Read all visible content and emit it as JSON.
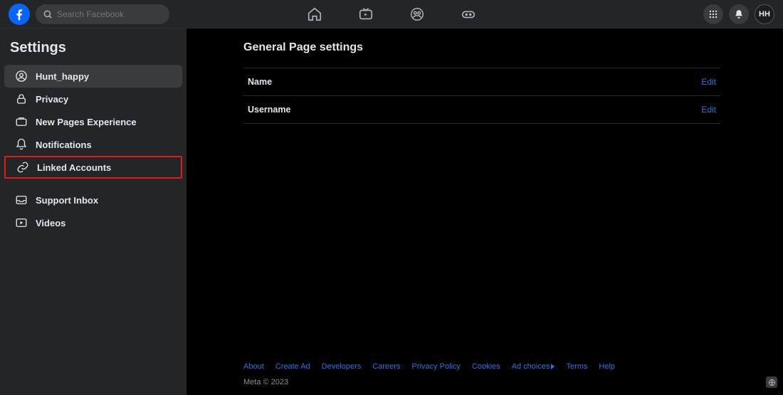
{
  "search": {
    "placeholder": "Search Facebook"
  },
  "avatar_initials": "HH",
  "sidebar": {
    "heading": "Settings",
    "items": [
      {
        "label": "Hunt_happy"
      },
      {
        "label": "Privacy"
      },
      {
        "label": "New Pages Experience"
      },
      {
        "label": "Notifications"
      },
      {
        "label": "Linked Accounts"
      },
      {
        "label": "Support Inbox"
      },
      {
        "label": "Videos"
      }
    ]
  },
  "main": {
    "title": "General Page settings",
    "rows": [
      {
        "label": "Name",
        "action": "Edit"
      },
      {
        "label": "Username",
        "action": "Edit"
      }
    ]
  },
  "footer": {
    "links": [
      "About",
      "Create Ad",
      "Developers",
      "Careers",
      "Privacy Policy",
      "Cookies",
      "Ad choices",
      "Terms",
      "Help"
    ],
    "copyright": "Meta © 2023"
  }
}
